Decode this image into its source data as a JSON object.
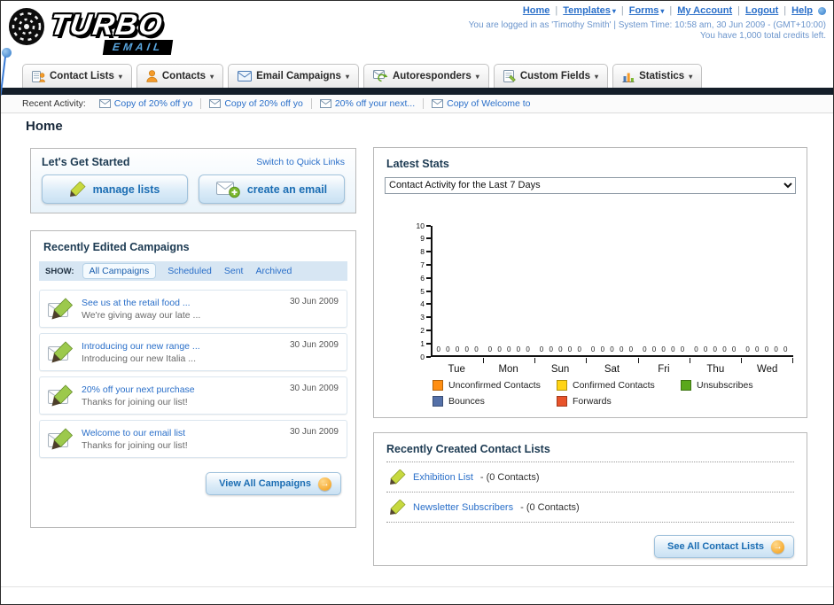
{
  "header": {
    "logo_primary": "TURBO",
    "logo_secondary": "EMAIL",
    "logo_icon": "speedometer-icon",
    "nav_links": [
      {
        "label": "Home",
        "has_dropdown": false
      },
      {
        "label": "Templates",
        "has_dropdown": true
      },
      {
        "label": "Forms",
        "has_dropdown": true
      },
      {
        "label": "My Account",
        "has_dropdown": false
      },
      {
        "label": "Logout",
        "has_dropdown": false
      },
      {
        "label": "Help",
        "has_dropdown": false
      }
    ],
    "login_info": "You are logged in as 'Timothy Smith' | System Time: 10:58 am, 30 Jun 2009 - (GMT+10:00)",
    "credits_info": "You have 1,000 total credits left."
  },
  "nav_tabs": [
    {
      "label": "Contact Lists",
      "icon": "contact-lists-icon"
    },
    {
      "label": "Contacts",
      "icon": "contacts-icon"
    },
    {
      "label": "Email Campaigns",
      "icon": "email-campaigns-icon"
    },
    {
      "label": "Autoresponders",
      "icon": "autoresponders-icon"
    },
    {
      "label": "Custom Fields",
      "icon": "custom-fields-icon"
    },
    {
      "label": "Statistics",
      "icon": "statistics-icon"
    }
  ],
  "recent_activity": {
    "label": "Recent Activity:",
    "item_icon": "envelope-icon",
    "items": [
      "Copy of 20% off yo",
      "Copy of 20% off yo",
      "20% off your next...",
      "Copy of Welcome to"
    ]
  },
  "page_title": "Home",
  "get_started": {
    "title": "Let's Get Started",
    "switch_link": "Switch to Quick Links",
    "manage_lists_label": "manage lists",
    "manage_lists_icon": "pencil-icon",
    "create_email_label": "create an email",
    "create_email_icon": "envelope-plus-icon"
  },
  "campaigns": {
    "title": "Recently Edited Campaigns",
    "show_label": "SHOW:",
    "filters": [
      {
        "label": "All Campaigns",
        "selected": true
      },
      {
        "label": "Scheduled",
        "selected": false
      },
      {
        "label": "Sent",
        "selected": false
      },
      {
        "label": "Archived",
        "selected": false
      }
    ],
    "item_icon": "campaign-edit-icon",
    "items": [
      {
        "title": "See us at the retail food ...",
        "subtitle": "We're giving away our late ...",
        "date": "30 Jun 2009"
      },
      {
        "title": "Introducing our new range ...",
        "subtitle": "Introducing our new Italia ...",
        "date": "30 Jun 2009"
      },
      {
        "title": "20% off your next purchase",
        "subtitle": "Thanks for joining our list!",
        "date": "30 Jun 2009"
      },
      {
        "title": "Welcome to our email list",
        "subtitle": "Thanks for joining our list!",
        "date": "30 Jun 2009"
      }
    ],
    "view_all_label": "View All Campaigns",
    "view_all_icon": "arrow-right-icon"
  },
  "stats": {
    "title": "Latest Stats",
    "period_selected": "Contact Activity for the Last 7 Days",
    "chart_data": {
      "type": "bar",
      "title": "Contact Activity for the Last 7 Days",
      "categories": [
        "Tue",
        "Mon",
        "Sun",
        "Sat",
        "Fri",
        "Thu",
        "Wed"
      ],
      "series": [
        {
          "name": "Unconfirmed Contacts",
          "color": "#ff8e12",
          "values": [
            0,
            0,
            0,
            0,
            0,
            0,
            0
          ]
        },
        {
          "name": "Confirmed Contacts",
          "color": "#ffd414",
          "values": [
            0,
            0,
            0,
            0,
            0,
            0,
            0
          ]
        },
        {
          "name": "Unsubscribes",
          "color": "#5aa81c",
          "values": [
            0,
            0,
            0,
            0,
            0,
            0,
            0
          ]
        },
        {
          "name": "Bounces",
          "color": "#5470a8",
          "values": [
            0,
            0,
            0,
            0,
            0,
            0,
            0
          ]
        },
        {
          "name": "Forwards",
          "color": "#e8532a",
          "values": [
            0,
            0,
            0,
            0,
            0,
            0,
            0
          ]
        }
      ],
      "ylim": [
        0,
        10
      ],
      "ytick_step": 1,
      "grid": false,
      "legend_position": "bottom"
    }
  },
  "contact_lists": {
    "title": "Recently Created Contact Lists",
    "item_icon": "pencil-icon",
    "items": [
      {
        "name": "Exhibition List",
        "detail": "- (0 Contacts)"
      },
      {
        "name": "Newsletter Subscribers",
        "detail": "- (0 Contacts)"
      }
    ],
    "see_all_label": "See All Contact Lists",
    "see_all_icon": "arrow-right-icon"
  },
  "colors": {
    "link_blue": "#2a6fc9",
    "accent_orange": "#f2990f",
    "dark_bar": "#141e29"
  }
}
